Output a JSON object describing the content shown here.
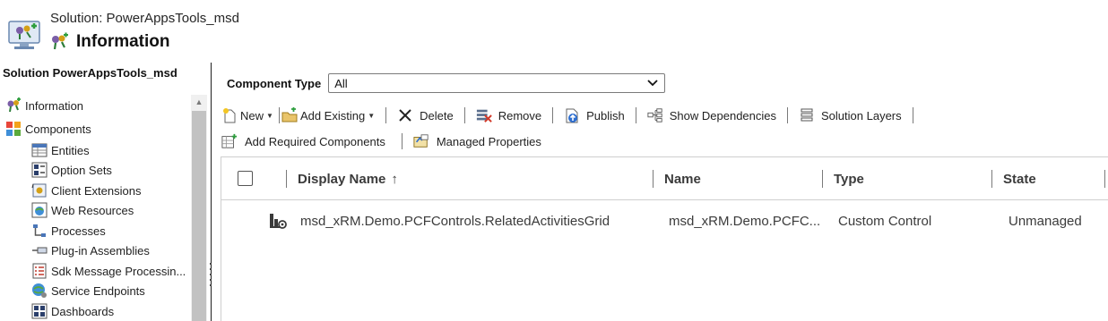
{
  "header": {
    "subtitle": "Solution: PowerAppsTools_msd",
    "title": "Information"
  },
  "nav": {
    "solution_title": "Solution PowerAppsTools_msd",
    "items": [
      {
        "label": "Information",
        "icon": "information-icon"
      },
      {
        "label": "Components",
        "icon": "components-icon"
      },
      {
        "label": "Entities",
        "icon": "entities-icon"
      },
      {
        "label": "Option Sets",
        "icon": "option-sets-icon"
      },
      {
        "label": "Client Extensions",
        "icon": "client-extensions-icon"
      },
      {
        "label": "Web Resources",
        "icon": "web-resources-icon"
      },
      {
        "label": "Processes",
        "icon": "processes-icon"
      },
      {
        "label": "Plug-in Assemblies",
        "icon": "plugin-assemblies-icon"
      },
      {
        "label": "Sdk Message Processin...",
        "icon": "sdk-message-icon"
      },
      {
        "label": "Service Endpoints",
        "icon": "service-endpoints-icon"
      },
      {
        "label": "Dashboards",
        "icon": "dashboards-icon"
      }
    ]
  },
  "component_type": {
    "label": "Component Type",
    "selected": "All"
  },
  "toolbar": {
    "new": "New",
    "add_existing": "Add Existing",
    "delete": "Delete",
    "remove": "Remove",
    "publish": "Publish",
    "show_dependencies": "Show Dependencies",
    "solution_layers": "Solution Layers",
    "add_required": "Add Required Components",
    "managed_properties": "Managed Properties"
  },
  "grid": {
    "columns": [
      "Display Name",
      "Name",
      "Type",
      "State"
    ],
    "sort_indicator": "↑",
    "rows": [
      {
        "display_name": "msd_xRM.Demo.PCFControls.RelatedActivitiesGrid",
        "name": "msd_xRM.Demo.PCFC...",
        "type": "Custom Control",
        "state": "Unmanaged"
      }
    ]
  }
}
